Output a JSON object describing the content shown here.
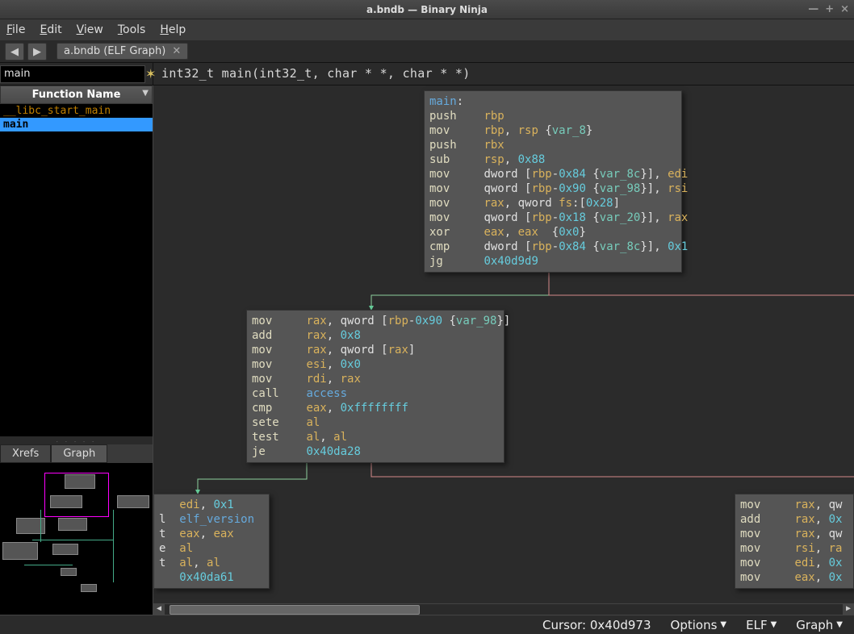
{
  "window": {
    "title": "a.bndb — Binary Ninja"
  },
  "menu": {
    "file": "File",
    "edit": "Edit",
    "view": "View",
    "tools": "Tools",
    "help": "Help"
  },
  "tabs": {
    "file_tab": "a.bndb (ELF Graph)"
  },
  "search": {
    "value": "main"
  },
  "signature": "int32_t main(int32_t, char * *, char * *)",
  "function_list": {
    "header": "Function Name",
    "items": [
      "__libc_start_main",
      "main"
    ],
    "selected": "main"
  },
  "side_tabs": {
    "xrefs": "Xrefs",
    "graph": "Graph"
  },
  "blocks": {
    "b1": {
      "lines": [
        [
          [
            "lbl",
            "main"
          ],
          [
            "txt",
            ":"
          ]
        ],
        [
          [
            "op",
            "push    "
          ],
          [
            "reg",
            "rbp"
          ]
        ],
        [
          [
            "op",
            "mov     "
          ],
          [
            "reg",
            "rbp"
          ],
          [
            "txt",
            ", "
          ],
          [
            "reg",
            "rsp"
          ],
          [
            "txt",
            " {"
          ],
          [
            "var",
            "var_8"
          ],
          [
            "txt",
            "}"
          ]
        ],
        [
          [
            "op",
            "push    "
          ],
          [
            "reg",
            "rbx"
          ]
        ],
        [
          [
            "op",
            "sub     "
          ],
          [
            "reg",
            "rsp"
          ],
          [
            "txt",
            ", "
          ],
          [
            "num",
            "0x88"
          ]
        ],
        [
          [
            "op",
            "mov     "
          ],
          [
            "txt",
            "dword ["
          ],
          [
            "reg",
            "rbp"
          ],
          [
            "txt",
            "-"
          ],
          [
            "num",
            "0x84"
          ],
          [
            "txt",
            " {"
          ],
          [
            "var",
            "var_8c"
          ],
          [
            "txt",
            "}], "
          ],
          [
            "reg",
            "edi"
          ]
        ],
        [
          [
            "op",
            "mov     "
          ],
          [
            "txt",
            "qword ["
          ],
          [
            "reg",
            "rbp"
          ],
          [
            "txt",
            "-"
          ],
          [
            "num",
            "0x90"
          ],
          [
            "txt",
            " {"
          ],
          [
            "var",
            "var_98"
          ],
          [
            "txt",
            "}], "
          ],
          [
            "reg",
            "rsi"
          ]
        ],
        [
          [
            "op",
            "mov     "
          ],
          [
            "reg",
            "rax"
          ],
          [
            "txt",
            ", qword "
          ],
          [
            "reg",
            "fs"
          ],
          [
            "txt",
            ":["
          ],
          [
            "num",
            "0x28"
          ],
          [
            "txt",
            "]"
          ]
        ],
        [
          [
            "op",
            "mov     "
          ],
          [
            "txt",
            "qword ["
          ],
          [
            "reg",
            "rbp"
          ],
          [
            "txt",
            "-"
          ],
          [
            "num",
            "0x18"
          ],
          [
            "txt",
            " {"
          ],
          [
            "var",
            "var_20"
          ],
          [
            "txt",
            "}], "
          ],
          [
            "reg",
            "rax"
          ]
        ],
        [
          [
            "op",
            "xor     "
          ],
          [
            "reg",
            "eax"
          ],
          [
            "txt",
            ", "
          ],
          [
            "reg",
            "eax"
          ],
          [
            "txt",
            "  {"
          ],
          [
            "num",
            "0x0"
          ],
          [
            "txt",
            "}"
          ]
        ],
        [
          [
            "op",
            "cmp     "
          ],
          [
            "txt",
            "dword ["
          ],
          [
            "reg",
            "rbp"
          ],
          [
            "txt",
            "-"
          ],
          [
            "num",
            "0x84"
          ],
          [
            "txt",
            " {"
          ],
          [
            "var",
            "var_8c"
          ],
          [
            "txt",
            "}], "
          ],
          [
            "num",
            "0x1"
          ]
        ],
        [
          [
            "op",
            "jg      "
          ],
          [
            "num",
            "0x40d9d9"
          ]
        ]
      ]
    },
    "b2": {
      "lines": [
        [
          [
            "op",
            "mov     "
          ],
          [
            "reg",
            "rax"
          ],
          [
            "txt",
            ", qword ["
          ],
          [
            "reg",
            "rbp"
          ],
          [
            "txt",
            "-"
          ],
          [
            "num",
            "0x90"
          ],
          [
            "txt",
            " {"
          ],
          [
            "var",
            "var_98"
          ],
          [
            "txt",
            "}]"
          ]
        ],
        [
          [
            "op",
            "add     "
          ],
          [
            "reg",
            "rax"
          ],
          [
            "txt",
            ", "
          ],
          [
            "num",
            "0x8"
          ]
        ],
        [
          [
            "op",
            "mov     "
          ],
          [
            "reg",
            "rax"
          ],
          [
            "txt",
            ", qword ["
          ],
          [
            "reg",
            "rax"
          ],
          [
            "txt",
            "]"
          ]
        ],
        [
          [
            "op",
            "mov     "
          ],
          [
            "reg",
            "esi"
          ],
          [
            "txt",
            ", "
          ],
          [
            "num",
            "0x0"
          ]
        ],
        [
          [
            "op",
            "mov     "
          ],
          [
            "reg",
            "rdi"
          ],
          [
            "txt",
            ", "
          ],
          [
            "reg",
            "rax"
          ]
        ],
        [
          [
            "op",
            "call    "
          ],
          [
            "fn",
            "access"
          ]
        ],
        [
          [
            "op",
            "cmp     "
          ],
          [
            "reg",
            "eax"
          ],
          [
            "txt",
            ", "
          ],
          [
            "num",
            "0xffffffff"
          ]
        ],
        [
          [
            "op",
            "sete    "
          ],
          [
            "reg",
            "al"
          ]
        ],
        [
          [
            "op",
            "test    "
          ],
          [
            "reg",
            "al"
          ],
          [
            "txt",
            ", "
          ],
          [
            "reg",
            "al"
          ]
        ],
        [
          [
            "op",
            "je      "
          ],
          [
            "num",
            "0x40da28"
          ]
        ]
      ]
    },
    "b3": {
      "lines": [
        [
          [
            "txt",
            "   "
          ],
          [
            "reg",
            "edi"
          ],
          [
            "txt",
            ", "
          ],
          [
            "num",
            "0x1"
          ]
        ],
        [
          [
            "txt",
            "l  "
          ],
          [
            "fn",
            "elf_version"
          ]
        ],
        [
          [
            "txt",
            "t  "
          ],
          [
            "reg",
            "eax"
          ],
          [
            "txt",
            ", "
          ],
          [
            "reg",
            "eax"
          ]
        ],
        [
          [
            "txt",
            "e  "
          ],
          [
            "reg",
            "al"
          ]
        ],
        [
          [
            "txt",
            "t  "
          ],
          [
            "reg",
            "al"
          ],
          [
            "txt",
            ", "
          ],
          [
            "reg",
            "al"
          ]
        ],
        [
          [
            "txt",
            "   "
          ],
          [
            "num",
            "0x40da61"
          ]
        ]
      ]
    },
    "b4": {
      "lines": [
        [
          [
            "op",
            "mov     "
          ],
          [
            "reg",
            "rax"
          ],
          [
            "txt",
            ", qw"
          ]
        ],
        [
          [
            "op",
            "add     "
          ],
          [
            "reg",
            "rax"
          ],
          [
            "txt",
            ", "
          ],
          [
            "num",
            "0x"
          ]
        ],
        [
          [
            "op",
            "mov     "
          ],
          [
            "reg",
            "rax"
          ],
          [
            "txt",
            ", qw"
          ]
        ],
        [
          [
            "op",
            "mov     "
          ],
          [
            "reg",
            "rsi"
          ],
          [
            "txt",
            ", "
          ],
          [
            "reg",
            "ra"
          ]
        ],
        [
          [
            "op",
            "mov     "
          ],
          [
            "reg",
            "edi"
          ],
          [
            "txt",
            ", "
          ],
          [
            "num",
            "0x"
          ]
        ],
        [
          [
            "op",
            "mov     "
          ],
          [
            "reg",
            "eax"
          ],
          [
            "txt",
            ", "
          ],
          [
            "num",
            "0x"
          ]
        ]
      ]
    }
  },
  "status": {
    "cursor": "Cursor: 0x40d973",
    "options": "Options",
    "format": "ELF",
    "view": "Graph"
  }
}
